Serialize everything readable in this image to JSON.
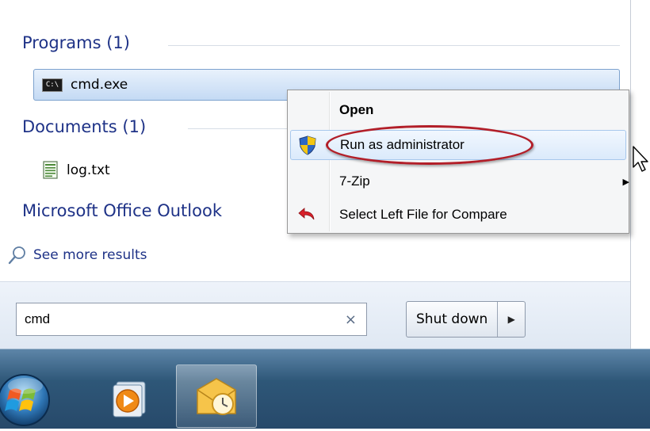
{
  "search_results": {
    "programs_header": "Programs (1)",
    "program_item": "cmd.exe",
    "cmd_icon_text": "C:\\",
    "documents_header": "Documents (1)",
    "document_item": "log.txt",
    "outlook_header": "Microsoft Office Outlook",
    "see_more": "See more results"
  },
  "search": {
    "value": "cmd",
    "clear_glyph": "×"
  },
  "power": {
    "shutdown_label": "Shut down",
    "arrow_glyph": "▶"
  },
  "context_menu": {
    "items": [
      {
        "label": "Open",
        "bold": true,
        "icon": null
      },
      {
        "label": "Run as administrator",
        "icon": "uac-shield-icon",
        "hovered": true
      },
      {
        "label": "7-Zip",
        "icon": null,
        "submenu": true
      },
      {
        "label": "Select Left File for Compare",
        "icon": "compare-arrow-icon"
      }
    ],
    "submenu_glyph": "▶"
  },
  "taskbar": {
    "items": [
      "start-orb",
      "media-player",
      "outlook"
    ]
  },
  "colors": {
    "header_blue": "#1e3287",
    "highlight_red": "#b21e28",
    "taskbar": "#2e5778"
  }
}
